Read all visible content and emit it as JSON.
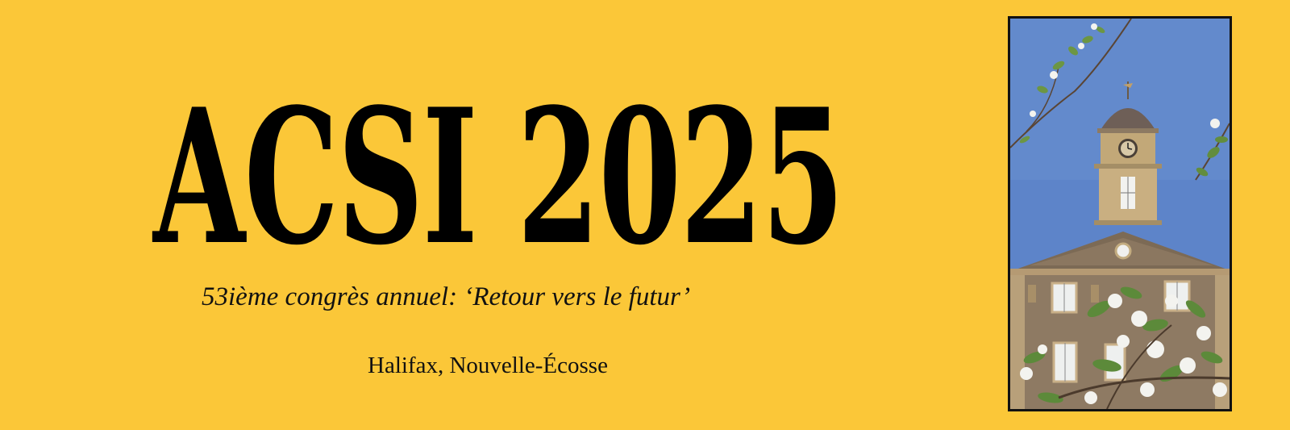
{
  "banner": {
    "title": "ACSI 2025",
    "subtitle": "53ième congrès annuel: ‘Retour vers le futur’",
    "location": "Halifax, Nouvelle-Écosse"
  },
  "colors": {
    "background": "#fbc738",
    "text": "#000000",
    "sky": "#5d84c9",
    "stone": "#b59a73",
    "blossom": "#f3f3ef",
    "leaf": "#5f8a3a"
  },
  "photo": {
    "subject": "building-clock-tower-with-blossoms"
  }
}
